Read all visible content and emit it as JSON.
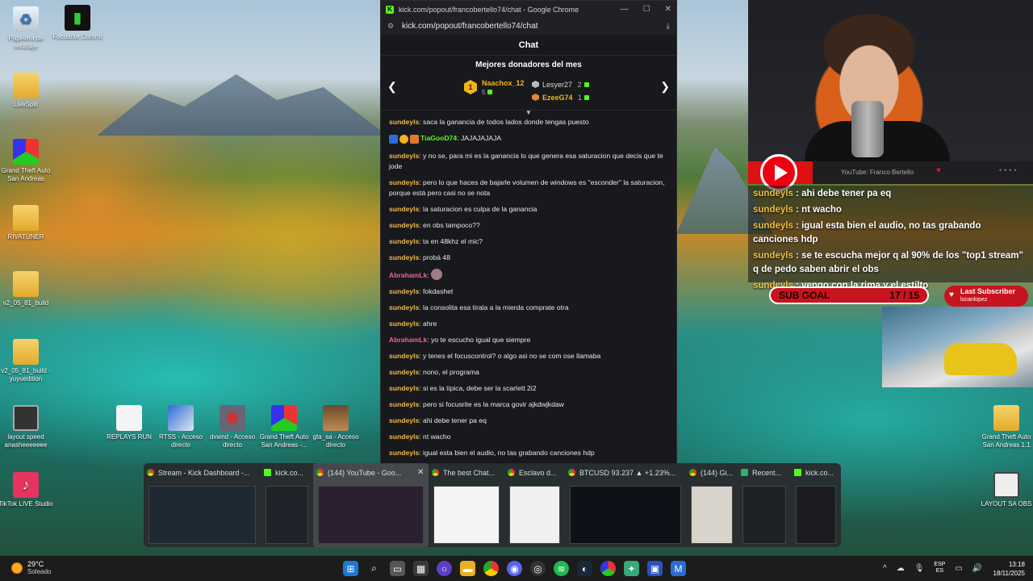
{
  "desktop": {
    "icons": [
      {
        "label": "Papelera de reciclaje",
        "icon": "recycle-bin-icon"
      },
      {
        "label": "Focusrite Control",
        "icon": "focusrite-icon"
      },
      {
        "label": "LiveSplit",
        "icon": "folder-icon"
      },
      {
        "label": "Grand Theft Auto San Andreas",
        "icon": "gta-icon"
      },
      {
        "label": "RIVATUNER",
        "icon": "folder-icon"
      },
      {
        "label": "v2_05_81_build",
        "icon": "folder-icon"
      },
      {
        "label": "v2_05_81_build - yuyuedition",
        "icon": "folder-icon"
      },
      {
        "label": "layout speed anasheeeeeee",
        "icon": "laptop-icon"
      },
      {
        "label": "REPLAYS RUN",
        "icon": "document-icon"
      },
      {
        "label": "RTSS - Acceso directo",
        "icon": "rtss-icon"
      },
      {
        "label": "dxwnd - Acceso directo",
        "icon": "dxwnd-icon"
      },
      {
        "label": "Grand Theft Auto San Andreas -...",
        "icon": "gta-icon"
      },
      {
        "label": "gta_sa - Acceso directo",
        "icon": "photo-icon"
      },
      {
        "label": "TikTok LIVE Studio",
        "icon": "tiktok-icon"
      },
      {
        "label": "Grand Theft Auto San Andreas 1.1",
        "icon": "folder-icon"
      },
      {
        "label": "LAYOUT SA OBS",
        "icon": "laptop-icon"
      }
    ]
  },
  "chrome": {
    "window_title": "kick.com/popout/francobertello74/chat - Google Chrome",
    "url": "kick.com/popout/francobertello74/chat",
    "controls": {
      "minimize": "—",
      "maximize": "☐",
      "close": "✕"
    }
  },
  "chat": {
    "header": "Chat",
    "donors_title": "Mejores donadores del mes",
    "top_donor": {
      "rank": "1",
      "name": "Naachox_12",
      "amount": "5"
    },
    "donor2": {
      "name": "Lesyer27",
      "amount": "2"
    },
    "donor3": {
      "name": "EzeeG74",
      "amount": "1"
    },
    "messages": [
      {
        "user": "sundeyls",
        "text": "saca la ganancia de todos lados donde tengas puesto",
        "color": "#f0b84a"
      },
      {
        "user": "TiaGooD74",
        "text": "JAJAJAJAJA",
        "color": "#53fc18",
        "badges": true
      },
      {
        "user": "sundeyls",
        "text": "y no se, para mi es la ganancia lo que genera esa saturacion que decis que te jode",
        "color": "#f0b84a"
      },
      {
        "user": "sundeyls",
        "text": "pero lo que haces de bajarle volumen de windows es \"esconder\" la saturacion, porque está pero casi no se nota",
        "color": "#f0b84a"
      },
      {
        "user": "sundeyls",
        "text": "la saturacion es culpa de la ganancia",
        "color": "#f0b84a"
      },
      {
        "user": "sundeyls",
        "text": "en obs tampoco??",
        "color": "#f0b84a"
      },
      {
        "user": "sundeyls",
        "text": "ta en 48khz el mic?",
        "color": "#f0b84a"
      },
      {
        "user": "sundeyls",
        "text": "probá 48",
        "color": "#f0b84a"
      },
      {
        "user": "AbrahamLk",
        "text": "",
        "color": "#f06292",
        "emote": true
      },
      {
        "user": "sundeyls",
        "text": "fokdashet",
        "color": "#f0b84a"
      },
      {
        "user": "sundeyls",
        "text": "la consolita esa tirala a la mierda comprate otra",
        "color": "#f0b84a"
      },
      {
        "user": "sundeyls",
        "text": "ahre",
        "color": "#f0b84a"
      },
      {
        "user": "AbrahamLk",
        "text": "yo te escucho igual que siempre",
        "color": "#f06292"
      },
      {
        "user": "sundeyls",
        "text": "y tenes el focuscontrol? o algo asi no se com ose llamaba",
        "color": "#f0b84a"
      },
      {
        "user": "sundeyls",
        "text": "nono, el programa",
        "color": "#f0b84a"
      },
      {
        "user": "sundeyls",
        "text": "si es la tipica, debe ser la scarlett 2i2",
        "color": "#f0b84a"
      },
      {
        "user": "sundeyls",
        "text": "pero si focusrite es la marca govir ajkdwjkdaw",
        "color": "#f0b84a"
      },
      {
        "user": "sundeyls",
        "text": "ahi debe tener pa eq",
        "color": "#f0b84a"
      },
      {
        "user": "sundeyls",
        "text": "nt wacho",
        "color": "#f0b84a"
      },
      {
        "user": "sundeyls",
        "text": "igual esta bien el audio, no tas grabando canciones hdp",
        "color": "#f0b84a"
      },
      {
        "user": "sundeyls",
        "text": "se te escucha mejor q al 90% de los \"top1 stream\" q de pedo saben abrir",
        "color": "#f0b84a"
      }
    ]
  },
  "stream_overlay": {
    "youtube_label": "YouTube: Franco Bertello",
    "chat": [
      {
        "user": "sundeyls",
        "text": "ahi debe tener pa eq"
      },
      {
        "user": "sundeyls",
        "text": "nt wacho"
      },
      {
        "user": "sundeyls",
        "text": "igual esta bien el audio, no tas grabando canciones hdp"
      },
      {
        "user": "sundeyls",
        "text": "se te escucha mejor q al 90% de los \"top1 stream\" q de pedo saben abrir el obs"
      },
      {
        "user": "sundeyls",
        "text": "vengo con la rima y el estilto"
      }
    ],
    "sub_goal_label": "SUB GOAL",
    "sub_goal_count": "17 / 15",
    "last_subscriber_label": "Last Subscriber",
    "last_subscriber_name": "lucanlopez"
  },
  "thumbnails": [
    {
      "title": "Stream - Kick Dashboard -...",
      "icon": "chrome-icon"
    },
    {
      "title": "kick.co...",
      "icon": "kick-icon"
    },
    {
      "title": "(144) YouTube - Goo...",
      "icon": "chrome-icon",
      "close": "✕"
    },
    {
      "title": "The best Chat...",
      "icon": "chrome-icon"
    },
    {
      "title": "Esclavo d...",
      "icon": "chrome-icon"
    },
    {
      "title": "BTCUSD 93.237 ▲ +1.23%...",
      "icon": "chrome-icon"
    },
    {
      "title": "(144) Gi...",
      "icon": "chrome-icon"
    },
    {
      "title": "Recent...",
      "icon": "green-icon"
    },
    {
      "title": "kick.co...",
      "icon": "kick-icon"
    }
  ],
  "taskbar": {
    "weather_temp": "29°C",
    "weather_cond": "Soleado",
    "lang_top": "ESP",
    "lang_bottom": "ES",
    "time": "13:18",
    "date": "18/11/2025",
    "tray_chevron": "^"
  }
}
